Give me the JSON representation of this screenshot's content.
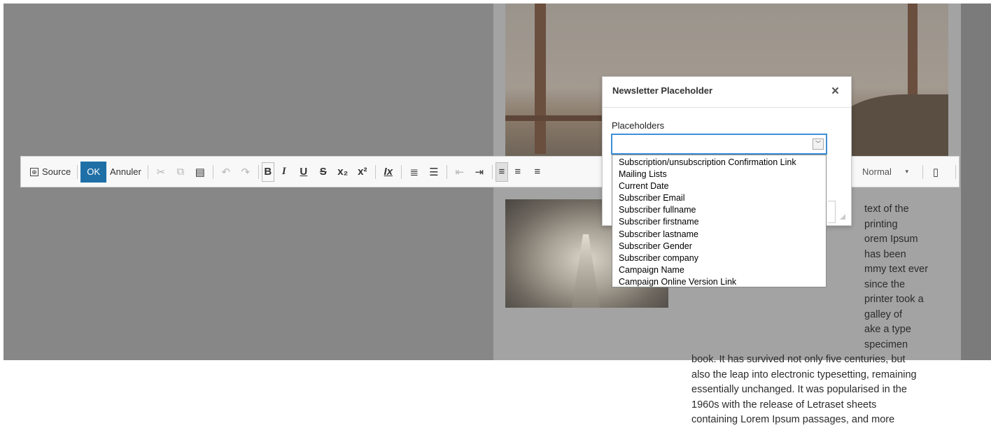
{
  "toolbar": {
    "source_label": "Source",
    "ok_label": "OK",
    "cancel_label": "Annuler",
    "format_value": "Normal"
  },
  "dialog": {
    "title": "Newsletter Placeholder",
    "close_glyph": "×",
    "field_label": "Placeholders",
    "select_value": "",
    "options": [
      "Subscription/unsubscription Confirmation Link",
      "Mailing Lists",
      "Current Date",
      "Subscriber Email",
      "Subscriber fullname",
      "Subscriber firstname",
      "Subscriber lastname",
      "Subscriber Gender",
      "Subscriber company",
      "Campaign Name",
      "Campaign Online Version Link"
    ]
  },
  "paragraph": {
    "lines": [
      "text of the printing",
      "orem Ipsum has been",
      "mmy text ever since the",
      "printer took a galley of",
      "ake a type specimen",
      "book. It has survived not only five centuries, but",
      "also the leap into electronic typesetting, remaining",
      "essentially unchanged. It was popularised in the",
      "1960s with the release of Letraset sheets",
      "containing Lorem Ipsum passages, and more"
    ]
  }
}
